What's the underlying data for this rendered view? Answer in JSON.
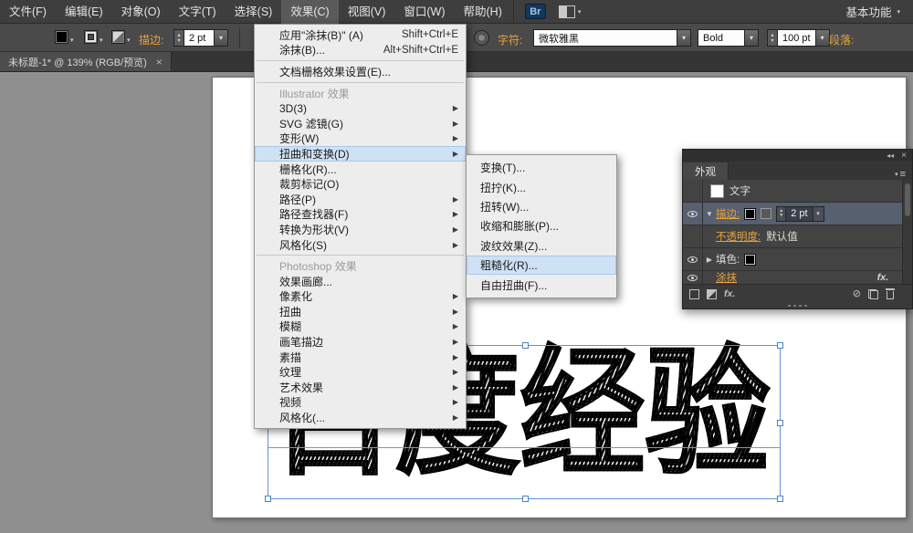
{
  "glyphs": {
    "dropdown_arrow": "▾",
    "stepper_up": "▲",
    "stepper_down": "▼",
    "submenu_arrow": "▶",
    "disclosure_open": "▼",
    "disclosure_closed": "▶",
    "collapse_chevrons": "◂◂",
    "close_x": "×",
    "panel_menu": "≡"
  },
  "colors": {
    "accent_orange": "#e8a33d",
    "menu_highlight": "#cfe1f5",
    "selection_blue": "#5f94d4"
  },
  "menubar": {
    "items": [
      {
        "label": "文件(F)"
      },
      {
        "label": "编辑(E)"
      },
      {
        "label": "对象(O)"
      },
      {
        "label": "文字(T)"
      },
      {
        "label": "选择(S)"
      },
      {
        "label": "效果(C)",
        "active": true
      },
      {
        "label": "视图(V)"
      },
      {
        "label": "窗口(W)"
      },
      {
        "label": "帮助(H)"
      }
    ],
    "bridge_label": "Br",
    "workspace_label": "基本功能"
  },
  "toolbar": {
    "stroke_label": "描边:",
    "stroke_value": "2 pt",
    "char_label": "字符:",
    "font_family_value": "微软雅黑",
    "font_weight_value": "Bold",
    "font_size_value": "100 pt",
    "paragraph_label": "段落:"
  },
  "tabbar": {
    "doc_title": "未标题-1* @ 139% (RGB/预览)",
    "close_glyph": "×"
  },
  "effects_menu": {
    "items": [
      {
        "label": "应用\"涂抹(B)\" (A)",
        "shortcut": "Shift+Ctrl+E",
        "name": "menu-item-apply-scribble"
      },
      {
        "label": "涂抹(B)...",
        "shortcut": "Alt+Shift+Ctrl+E",
        "name": "menu-item-scribble"
      },
      {
        "type": "separator"
      },
      {
        "label": "文档栅格效果设置(E)...",
        "name": "menu-item-document-raster-effect-settings"
      },
      {
        "type": "separator"
      },
      {
        "type": "header",
        "label": "Illustrator 效果",
        "name": "menu-header-illustrator-effects"
      },
      {
        "label": "3D(3)",
        "arrow": true,
        "name": "menu-item-3d"
      },
      {
        "label": "SVG 滤镜(G)",
        "arrow": true,
        "name": "menu-item-svg-filters"
      },
      {
        "label": "变形(W)",
        "arrow": true,
        "name": "menu-item-warp"
      },
      {
        "label": "扭曲和变换(D)",
        "arrow": true,
        "highlight": true,
        "name": "menu-item-distort-and-transform"
      },
      {
        "label": "栅格化(R)...",
        "name": "menu-item-rasterize"
      },
      {
        "label": "裁剪标记(O)",
        "name": "menu-item-crop-marks"
      },
      {
        "label": "路径(P)",
        "arrow": true,
        "name": "menu-item-path"
      },
      {
        "label": "路径查找器(F)",
        "arrow": true,
        "name": "menu-item-pathfinder"
      },
      {
        "label": "转换为形状(V)",
        "arrow": true,
        "name": "menu-item-convert-to-shape"
      },
      {
        "label": "风格化(S)",
        "arrow": true,
        "name": "menu-item-stylize"
      },
      {
        "type": "separator"
      },
      {
        "type": "header",
        "label": "Photoshop 效果",
        "name": "menu-header-photoshop-effects"
      },
      {
        "label": "效果画廊...",
        "name": "menu-item-effect-gallery"
      },
      {
        "label": "像素化",
        "arrow": true,
        "name": "menu-item-pixelate"
      },
      {
        "label": "扭曲",
        "arrow": true,
        "name": "menu-item-distort"
      },
      {
        "label": "模糊",
        "arrow": true,
        "name": "menu-item-blur"
      },
      {
        "label": "画笔描边",
        "arrow": true,
        "name": "menu-item-brush-strokes"
      },
      {
        "label": "素描",
        "arrow": true,
        "name": "menu-item-sketch"
      },
      {
        "label": "纹理",
        "arrow": true,
        "name": "menu-item-texture"
      },
      {
        "label": "艺术效果",
        "arrow": true,
        "name": "menu-item-artistic"
      },
      {
        "label": "视频",
        "arrow": true,
        "name": "menu-item-video"
      },
      {
        "label": "风格化(...",
        "arrow": true,
        "name": "menu-item-stylize-ps"
      }
    ]
  },
  "distort_submenu": {
    "items": [
      {
        "label": "变换(T)...",
        "name": "submenu-item-transform"
      },
      {
        "label": "扭拧(K)...",
        "name": "submenu-item-pucker"
      },
      {
        "label": "扭转(W)...",
        "name": "submenu-item-twist"
      },
      {
        "label": "收缩和膨胀(P)...",
        "name": "submenu-item-pucker-and-bloat"
      },
      {
        "label": "波纹效果(Z)...",
        "name": "submenu-item-zigzag"
      },
      {
        "label": "粗糙化(R)...",
        "highlight": true,
        "name": "submenu-item-roughen"
      },
      {
        "label": "自由扭曲(F)...",
        "name": "submenu-item-free-distort"
      }
    ]
  },
  "appearance_panel": {
    "title": "外观",
    "type_row_label": "文字",
    "stroke_label": "描边:",
    "stroke_value": "2 pt",
    "opacity_label": "不透明度:",
    "opacity_value": "默认值",
    "fill_label": "填色:",
    "scribble_label": "涂抹",
    "fx_label": "fx."
  },
  "canvas": {
    "artboard_text": "百度经验"
  }
}
